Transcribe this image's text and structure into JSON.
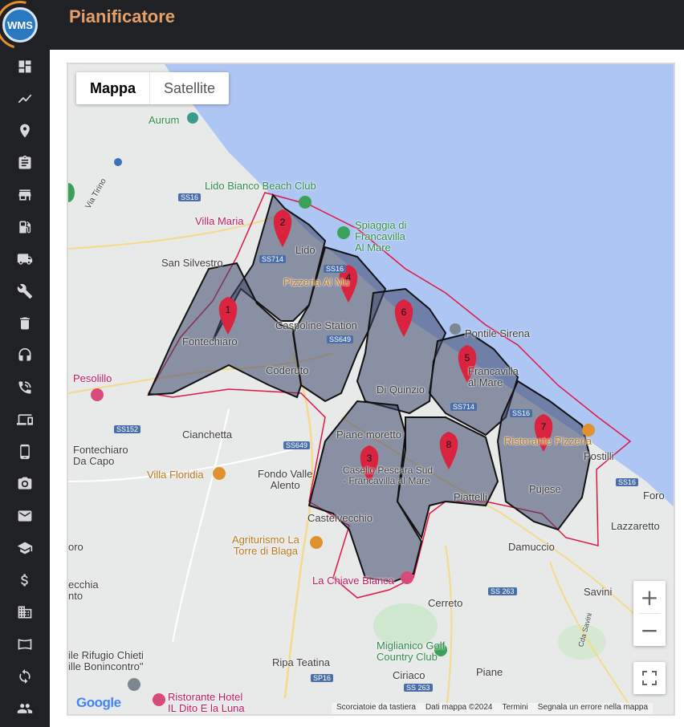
{
  "app": {
    "logo_text": "WMS",
    "page_title": "Pianificatore"
  },
  "sidebar": {
    "items": [
      {
        "icon": "dashboard-icon"
      },
      {
        "icon": "chart-line-icon"
      },
      {
        "icon": "map-pin-icon"
      },
      {
        "icon": "clipboard-icon"
      },
      {
        "icon": "store-icon"
      },
      {
        "icon": "fuel-icon"
      },
      {
        "icon": "truck-icon"
      },
      {
        "icon": "wrench-icon"
      },
      {
        "icon": "trash-icon"
      },
      {
        "icon": "headset-icon"
      },
      {
        "icon": "phone-call-icon"
      },
      {
        "icon": "devices-icon"
      },
      {
        "icon": "mobile-icon"
      },
      {
        "icon": "camera-icon"
      },
      {
        "icon": "mail-icon"
      },
      {
        "icon": "school-icon"
      },
      {
        "icon": "dollar-icon"
      },
      {
        "icon": "building-icon"
      },
      {
        "icon": "panorama-icon"
      },
      {
        "icon": "sync-icon"
      },
      {
        "icon": "people-icon"
      }
    ]
  },
  "map": {
    "map_type": {
      "map_label": "Mappa",
      "satellite_label": "Satellite"
    },
    "labels": {
      "aurum": "Aurum",
      "lido": "Lido Bianco Beach Club",
      "villa_maria": "Villa Maria",
      "spiaggia": "Spiaggia di\nFrancavilla\nAl Mare",
      "san_silvestro": "San Silvestro",
      "lido2": "Lido",
      "pizzeria": "Pizzeria Al Mu",
      "caspoline": "Caspoline Station",
      "pontile": "Pontile Sirena",
      "fontechiaro": "Fontechiaro",
      "pesolillo": "Pesolillo",
      "coderuto": "Coderuto",
      "di_quinzio": "Di Quinzio",
      "francavilla": "Francavilla\nal Mare",
      "fontechiaro_capo": "Fontechiaro\nDa Capo",
      "cianchetta": "Cianchetta",
      "piane_moretto": "Piane moretto",
      "ristorante_pizzeria": "Ristorante Pizzeria",
      "postilli": "Postilli",
      "villa_floridia": "Villa Floridia",
      "fondo_valle": "Fondo Valle\nAlento",
      "casello": "Casello Pescara Sud\n- Francavilla al Mare",
      "piattelli": "Piattelli",
      "pujese": "Pujese",
      "foro": "Foro",
      "castelvecchio": "Castelvecchio",
      "lazzaretto": "Lazzaretto",
      "agriturismo": "Agriturismo La\nTorre di Blaga",
      "damuccio": "Damuccio",
      "oro": "oro",
      "la_chiave": "La Chiave Bianca",
      "vecchia": "ecchia\nnto",
      "cerreto": "Cerreto",
      "savini": "Savini",
      "rifugio": "ile Rifugio Chieti\nille Bonincontro\"",
      "miglianico": "Miglianico Golf\nCountry Club",
      "ripa_teatina": "Ripa Teatina",
      "ciriaco": "Ciriaco",
      "piane": "Piane",
      "ristorante_hotel": "Ristorante Hotel\nIL Dito E la Luna",
      "via_tirino": "Via Tirino",
      "cda_savini": "Cda Savini"
    },
    "roads": [
      "SS16",
      "SS714",
      "SS16",
      "SS649",
      "SS714",
      "SS16",
      "SS152",
      "SS649",
      "SS16",
      "SS 263",
      "SP16",
      "SS 263"
    ],
    "markers": [
      "1",
      "2",
      "3",
      "4",
      "5",
      "6",
      "7",
      "8"
    ],
    "attribution": {
      "shortcuts": "Scorciatoie da tastiera",
      "data": "Dati mappa ©2024",
      "terms": "Termini",
      "report": "Segnala un errore nella mappa"
    },
    "google_logo": "Google",
    "colors": {
      "sea": "#aec6f4",
      "zone_fill": "#3d4a6b",
      "boundary": "#e01646",
      "marker": "#d9233f"
    }
  }
}
